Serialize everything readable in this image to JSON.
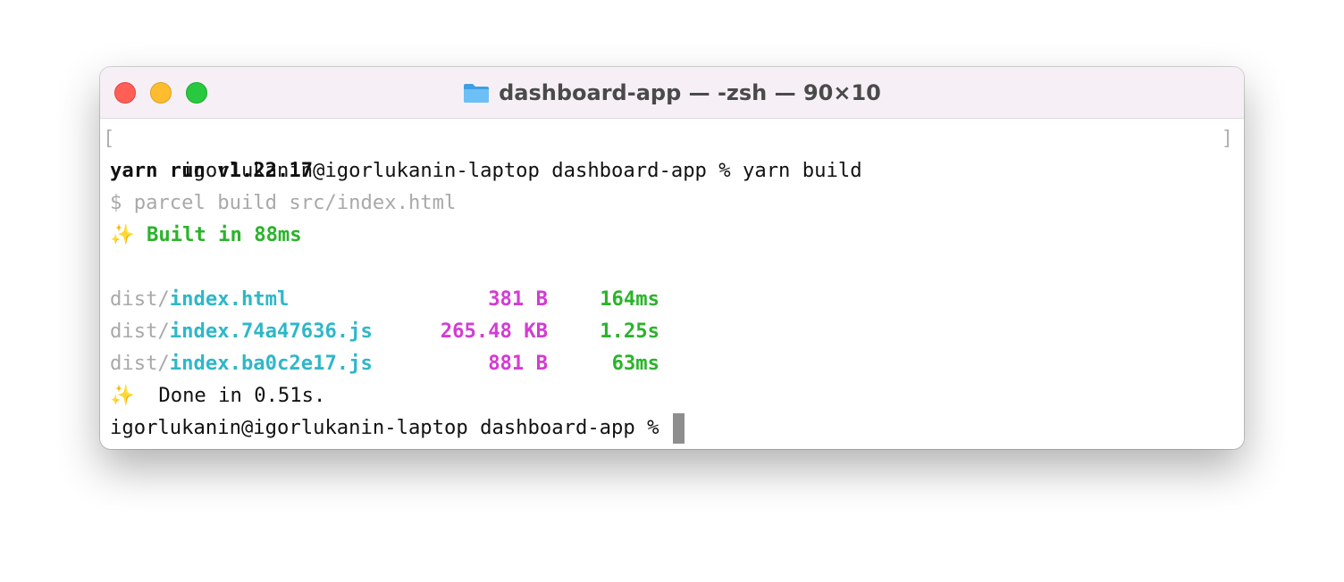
{
  "window": {
    "title": "dashboard-app — -zsh — 90×10",
    "title_icon": "folder-icon"
  },
  "terminal": {
    "line1": {
      "mark_left": "[",
      "text": "igorlukanin@igorlukanin-laptop dashboard-app % yarn build",
      "mark_right": "]"
    },
    "line2": "yarn run v1.22.17",
    "line3": "$ parcel build src/index.html",
    "line4": {
      "icon": "✨",
      "text": " Built in 88ms"
    },
    "files": [
      {
        "prefix": "dist/",
        "name": "index.html",
        "size": "381 B",
        "time": "164ms"
      },
      {
        "prefix": "dist/",
        "name": "index.74a47636.js",
        "size": "265.48 KB",
        "time": "1.25s"
      },
      {
        "prefix": "dist/",
        "name": "index.ba0c2e17.js",
        "size": "881 B",
        "time": "63ms"
      }
    ],
    "done": {
      "icon": "✨",
      "text": "  Done in 0.51s."
    },
    "prompt": "igorlukanin@igorlukanin-laptop dashboard-app % "
  },
  "colors": {
    "close": "#ff5f57",
    "minimize": "#febc2e",
    "maximize": "#28c840",
    "success_green": "#2bb32b",
    "file_cyan": "#2fb7c8",
    "size_magenta": "#d43bd4"
  }
}
